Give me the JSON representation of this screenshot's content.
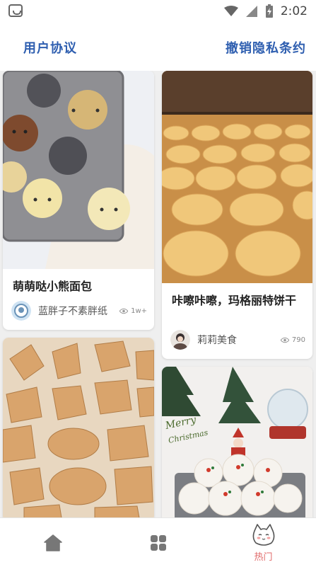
{
  "status_bar": {
    "time": "2:02"
  },
  "header": {
    "left_link": "用户协议",
    "right_link": "撤销隐私条约"
  },
  "cards": [
    {
      "title": "萌萌哒小熊面包",
      "author": "蓝胖子不素胖纸",
      "views": "1w+"
    },
    {
      "title": "咔嚓咔嚓，玛格丽特饼干",
      "author": "莉莉美食",
      "views": "790"
    },
    {
      "title": "",
      "author": "",
      "views": ""
    },
    {
      "title": "",
      "author": "",
      "views": ""
    }
  ],
  "tabbar": {
    "tabs": [
      {
        "icon": "home-icon",
        "label": ""
      },
      {
        "icon": "grid-icon",
        "label": ""
      },
      {
        "icon": "cat-icon",
        "label": "热门"
      }
    ]
  },
  "colors": {
    "accent": "#2f5fb0",
    "active_tab": "#e06a6a"
  }
}
